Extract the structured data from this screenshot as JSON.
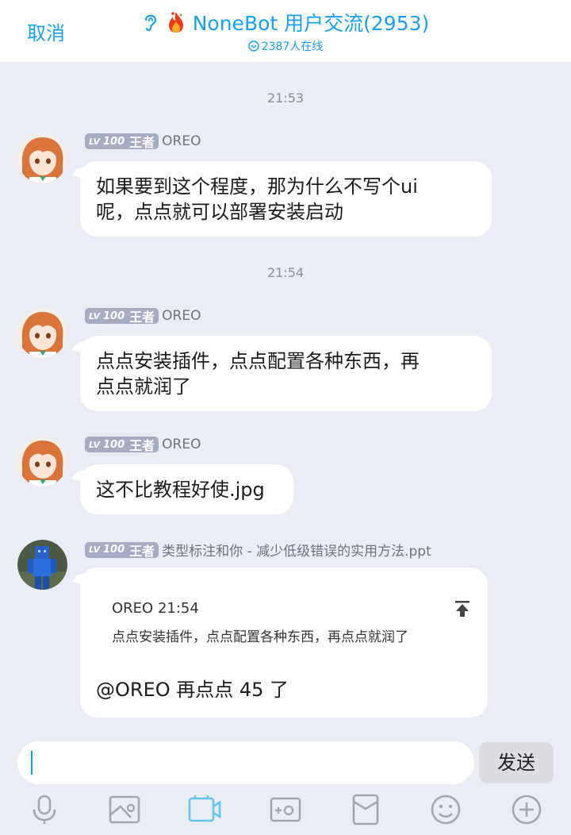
{
  "header": {
    "cancel_label": "取消",
    "group_name": "NoneBot 用户交流(2953)",
    "online_text": "2387人在线"
  },
  "messages": [
    {
      "time": "21:53",
      "level_tag": "LV",
      "level": "100",
      "rank": "王者",
      "sender": "OREO",
      "lines": [
        "如果要到这个程度，那为什么不写个ui",
        "呢，点点就可以部署安装启动"
      ]
    },
    {
      "time": "21:54",
      "level_tag": "LV",
      "level": "100",
      "rank": "王者",
      "sender": "OREO",
      "lines": [
        "点点安装插件，点点配置各种东西，再",
        "点点就润了"
      ]
    },
    {
      "level_tag": "LV",
      "level": "100",
      "rank": "王者",
      "sender": "OREO",
      "lines": [
        "这不比教程好使.jpg"
      ]
    },
    {
      "level_tag": "LV",
      "level": "100",
      "rank": "王者",
      "sender": "类型标注和你 - 减少低级错误的实用方法.ppt",
      "quote": {
        "header": "OREO 21:54",
        "text": "点点安装插件，点点配置各种东西，再点点就润了"
      },
      "reply": "@OREO 再点点 45 了"
    }
  ],
  "input": {
    "value": ""
  },
  "send_label": "发送",
  "toolbar_icons": [
    "microphone-icon",
    "image-icon",
    "video-icon",
    "camera-icon",
    "red-packet-icon",
    "emoji-icon",
    "plus-icon"
  ],
  "colors": {
    "accent": "#1a9ef0",
    "background": "#ebedf5",
    "badge": "#a8acc2"
  }
}
